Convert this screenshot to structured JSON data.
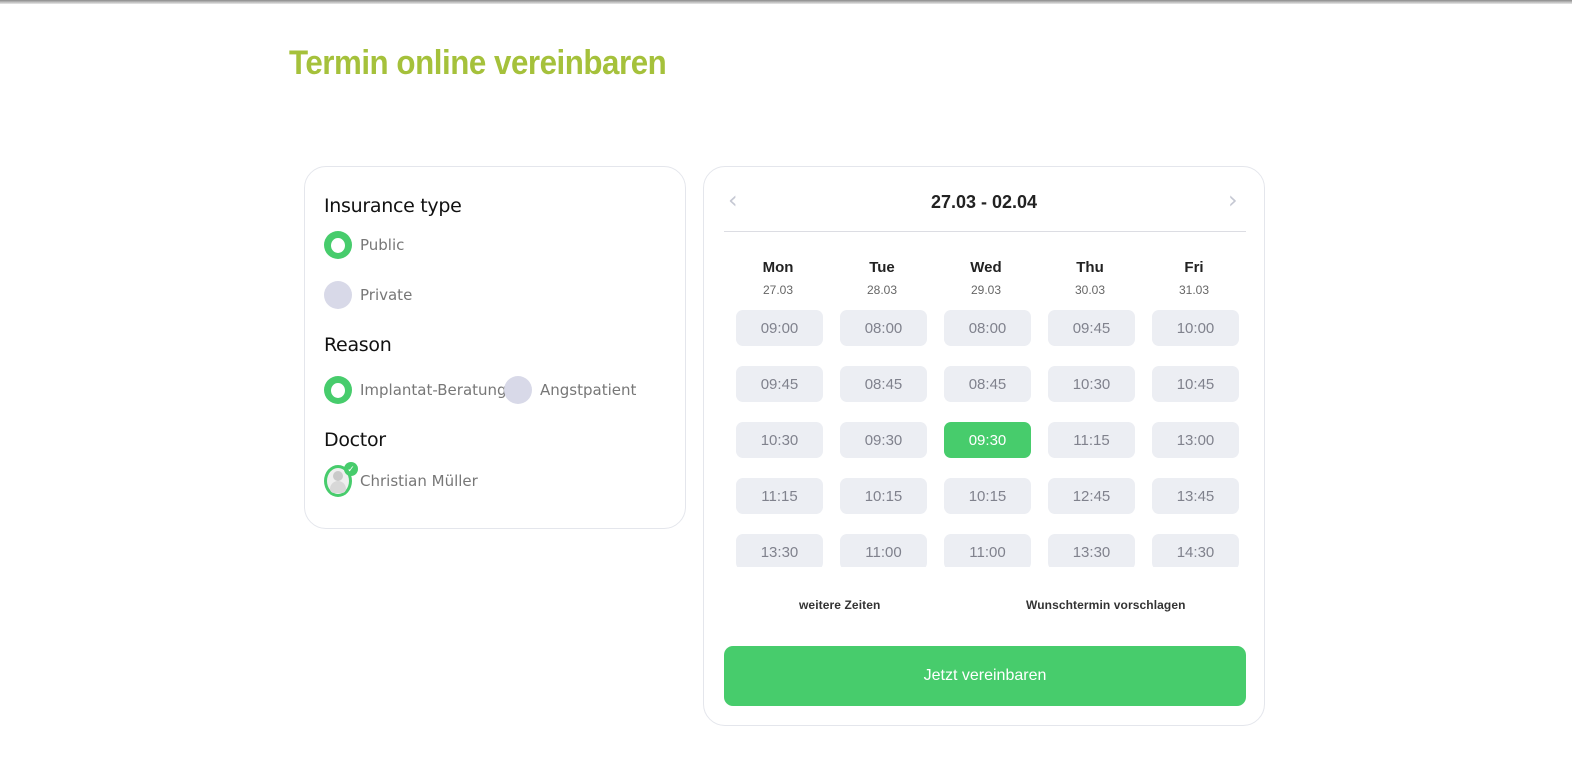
{
  "page": {
    "title": "Termin online vereinbaren"
  },
  "colors": {
    "accent_title": "#a5c13b",
    "primary": "#47cc6c",
    "slot_bg": "#eceef3",
    "radio_off": "#d8d9e8"
  },
  "filters": {
    "insurance": {
      "heading": "Insurance type",
      "options": [
        {
          "label": "Public",
          "selected": true
        },
        {
          "label": "Private",
          "selected": false
        }
      ]
    },
    "reason": {
      "heading": "Reason",
      "options": [
        {
          "label": "Implantat-Beratung",
          "selected": true
        },
        {
          "label": "Angstpatient",
          "selected": false
        }
      ]
    },
    "doctor": {
      "heading": "Doctor",
      "name": "Christian Müller",
      "selected": true
    }
  },
  "calendar": {
    "range_label": "27.03 - 02.04",
    "prev_icon": "chevron-left-icon",
    "next_icon": "chevron-right-icon",
    "days": [
      {
        "name": "Mon",
        "date": "27.03",
        "slots": [
          "09:00",
          "09:45",
          "10:30",
          "11:15",
          "13:30"
        ]
      },
      {
        "name": "Tue",
        "date": "28.03",
        "slots": [
          "08:00",
          "08:45",
          "09:30",
          "10:15",
          "11:00"
        ]
      },
      {
        "name": "Wed",
        "date": "29.03",
        "slots": [
          "08:00",
          "08:45",
          "09:30",
          "10:15",
          "11:00"
        ]
      },
      {
        "name": "Thu",
        "date": "30.03",
        "slots": [
          "09:45",
          "10:30",
          "11:15",
          "12:45",
          "13:30"
        ]
      },
      {
        "name": "Fri",
        "date": "31.03",
        "slots": [
          "10:00",
          "10:45",
          "13:00",
          "13:45",
          "14:30"
        ]
      }
    ],
    "selected_slot": {
      "day": "Wed",
      "time": "09:30"
    },
    "more_times_label": "weitere Zeiten",
    "suggest_label": "Wunschtermin vorschlagen",
    "submit_label": "Jetzt vereinbaren"
  }
}
